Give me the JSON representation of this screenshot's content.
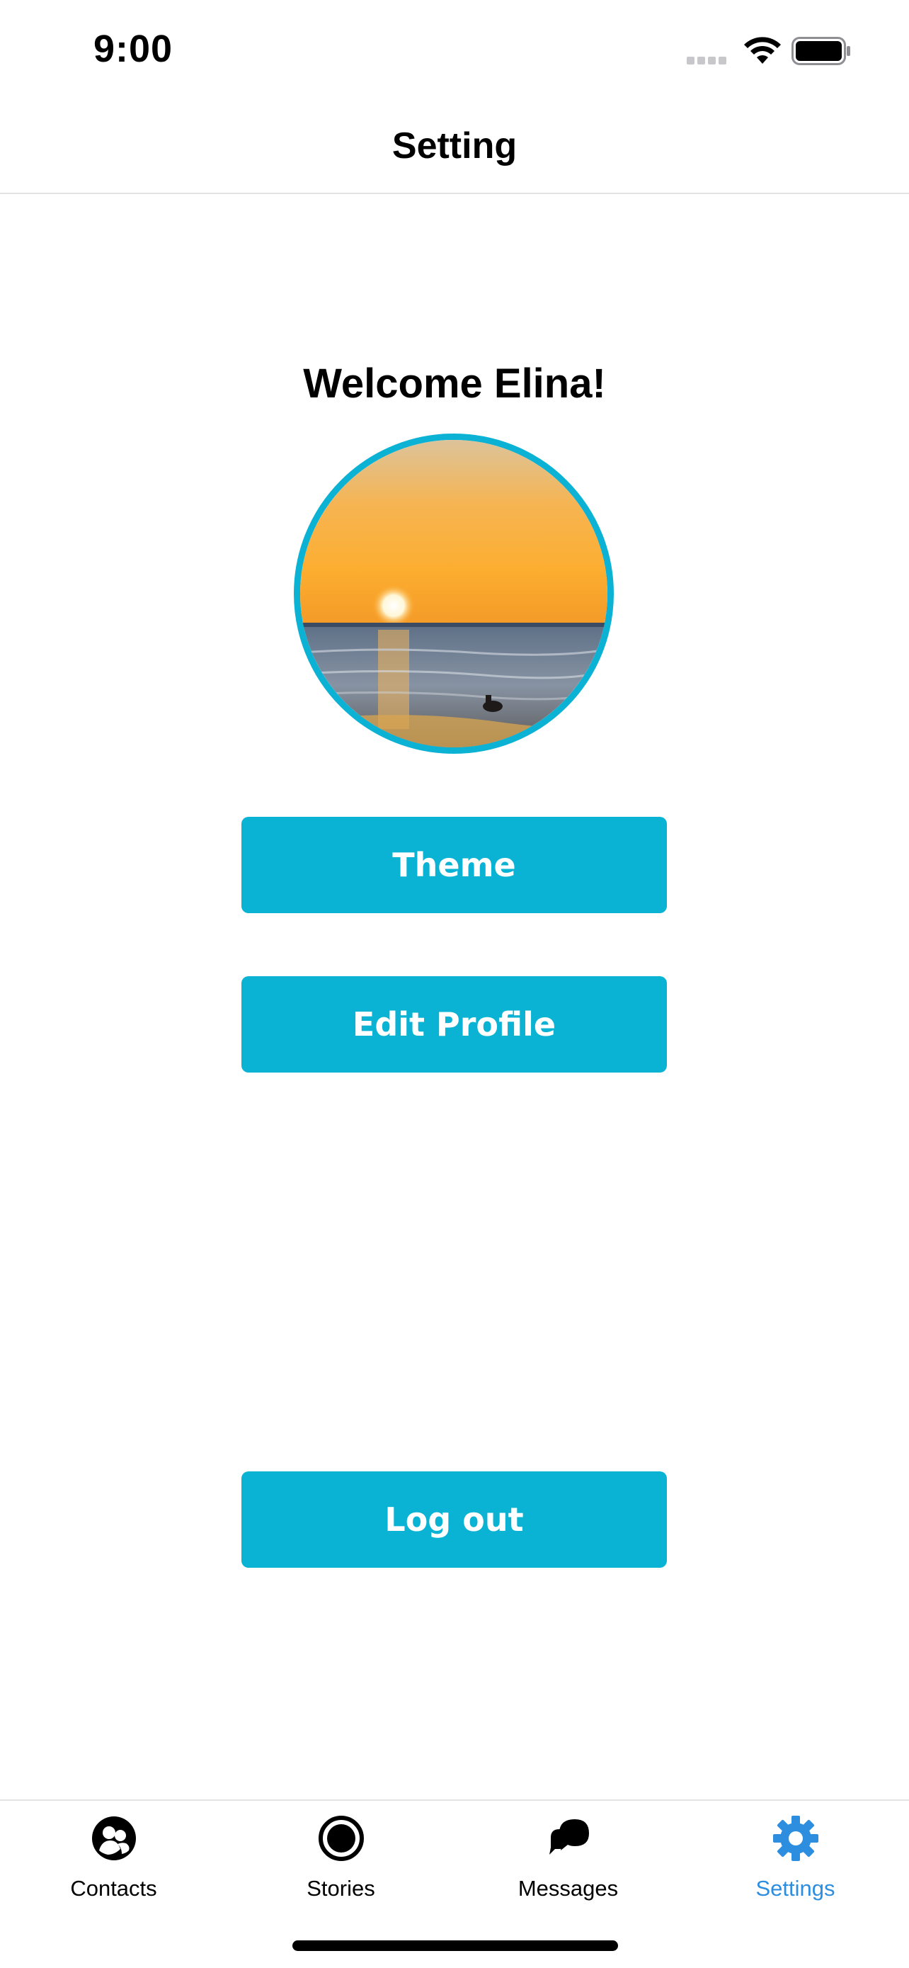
{
  "status_bar": {
    "time": "9:00",
    "signal_icon": "signal-dots-icon",
    "wifi_icon": "wifi-icon",
    "battery_icon": "battery-icon"
  },
  "nav": {
    "title": "Setting"
  },
  "profile": {
    "welcome_text": "Welcome Elina!",
    "avatar_icon": "profile-photo-sunset"
  },
  "buttons": {
    "theme": "Theme",
    "edit_profile": "Edit Profile",
    "logout": "Log out"
  },
  "tabs": [
    {
      "label": "Contacts",
      "icon": "contacts-icon",
      "active": false
    },
    {
      "label": "Stories",
      "icon": "stories-icon",
      "active": false
    },
    {
      "label": "Messages",
      "icon": "messages-icon",
      "active": false
    },
    {
      "label": "Settings",
      "icon": "gear-icon",
      "active": true
    }
  ],
  "colors": {
    "accent": "#0ab3d3",
    "active_tab": "#2d8ee0",
    "avatar_border": "#0bb2d4"
  }
}
